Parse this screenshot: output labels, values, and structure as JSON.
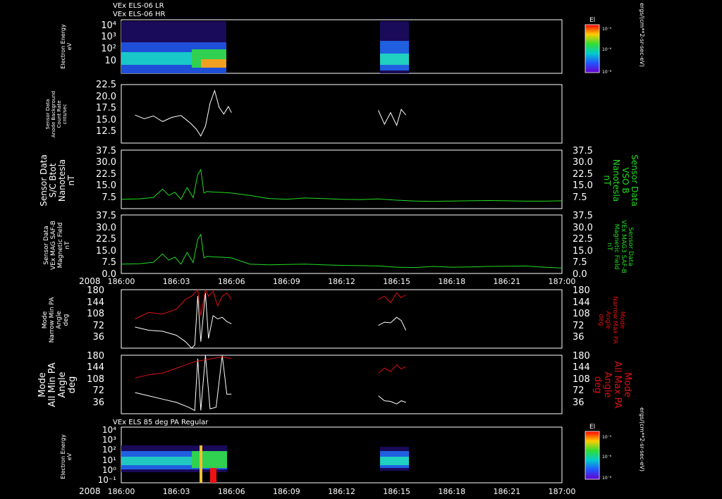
{
  "chart_data": [
    {
      "type": "heatmap",
      "titles": [
        "VEx ELS-06 LR",
        "VEx ELS-06 HR"
      ],
      "ylabel": [
        "Electron Energy",
        "eV"
      ],
      "yscale": "log",
      "yticks": [
        "10⁴",
        "10³",
        "10²",
        "10"
      ],
      "ylim": [
        1,
        20000
      ],
      "colorbar": {
        "label": "El",
        "unit": "ergs/(cm**2-sr-sec-eV)",
        "ticks": [
          "10⁻⁴",
          "10⁻⁶",
          "10⁻⁸"
        ]
      },
      "data_intervals": [
        [
          "186:00:45",
          "186:06:00"
        ],
        [
          "186:14:00",
          "186:15:30"
        ]
      ]
    },
    {
      "type": "line",
      "ylabel": [
        "Sensor Data",
        "Anode Background",
        "Count Rate",
        "cnts/sec"
      ],
      "yticks": [
        "22.5",
        "20.0",
        "17.5",
        "15.0",
        "12.5"
      ],
      "ylim": [
        10.0,
        22.5
      ],
      "series": [
        {
          "color": "#ffffff",
          "x": [
            "186:00:45",
            "186:01:15",
            "186:01:45",
            "186:02:15",
            "186:02:45",
            "186:03:15",
            "186:03:45",
            "186:04:05",
            "186:04:20",
            "186:04:35",
            "186:04:50",
            "186:05:05",
            "186:05:20",
            "186:05:35",
            "186:05:50",
            "186:06:00"
          ],
          "y": [
            16.0,
            15.2,
            15.8,
            14.6,
            15.5,
            15.9,
            14.3,
            13.0,
            11.5,
            13.6,
            18.5,
            21.2,
            17.6,
            16.2,
            17.8,
            16.5
          ]
        },
        {
          "color": "#ffffff",
          "x": [
            "186:14:00",
            "186:14:20",
            "186:14:40",
            "186:15:00",
            "186:15:15",
            "186:15:30"
          ],
          "y": [
            17.0,
            14.0,
            16.5,
            13.8,
            17.2,
            16.0
          ]
        }
      ]
    },
    {
      "type": "line",
      "ylabel": [
        "Sensor Data",
        "S/C Btot",
        "Nanotesla",
        "nT"
      ],
      "ylabel_right": [
        "Sensor Data",
        "VSO B",
        "Nanotesla",
        "nT"
      ],
      "yticks": [
        "37.5",
        "30.0",
        "22.5",
        "15.0",
        "7.5"
      ],
      "ylim": [
        0,
        37.5
      ],
      "series": [
        {
          "color": "#22dd22",
          "x": [
            "186:00:00",
            "186:01:00",
            "186:01:45",
            "186:02:15",
            "186:02:35",
            "186:02:55",
            "186:03:15",
            "186:03:35",
            "186:03:55",
            "186:04:10",
            "186:04:20",
            "186:04:30",
            "186:04:40",
            "186:05:00",
            "186:05:30",
            "186:06:00",
            "186:07:00",
            "186:08:00",
            "186:09:00",
            "186:10:00",
            "186:11:00",
            "186:12:00",
            "186:13:00",
            "186:14:00",
            "186:15:00",
            "186:16:00",
            "186:17:00",
            "186:18:00",
            "186:19:00",
            "186:20:00",
            "186:21:00",
            "186:22:00",
            "186:23:00",
            "186:24:00"
          ],
          "y": [
            6.0,
            6.3,
            7.2,
            12.5,
            8.5,
            10.5,
            6.0,
            13.5,
            7.0,
            22.0,
            25.0,
            10.0,
            11.0,
            10.6,
            10.4,
            10.0,
            8.5,
            6.5,
            6.0,
            6.8,
            6.4,
            6.0,
            5.8,
            6.2,
            5.4,
            4.9,
            4.6,
            4.9,
            5.0,
            5.2,
            5.0,
            4.8,
            4.8,
            5.0
          ]
        }
      ]
    },
    {
      "type": "line",
      "ylabel": [
        "Sensor Data",
        "VEx MAG SAF-B",
        "Magnetic Field",
        "nT"
      ],
      "ylabel_right": [
        "Sensor Data",
        "VEx MAG3 SAF-B",
        "Magnetic Field",
        "nT"
      ],
      "yticks": [
        "37.5",
        "30.0",
        "22.5",
        "15.0",
        "7.5",
        "0.0"
      ],
      "ylim": [
        0,
        37.5
      ],
      "series": [
        {
          "color": "#22dd22",
          "x": [
            "186:00:00",
            "186:01:00",
            "186:01:45",
            "186:02:15",
            "186:02:35",
            "186:02:55",
            "186:03:15",
            "186:03:35",
            "186:03:55",
            "186:04:10",
            "186:04:20",
            "186:04:30",
            "186:04:40",
            "186:05:00",
            "186:05:30",
            "186:06:00",
            "186:07:00",
            "186:08:00",
            "186:09:00",
            "186:10:00",
            "186:11:00",
            "186:12:00",
            "186:13:00",
            "186:14:00",
            "186:15:00",
            "186:16:00",
            "186:17:00",
            "186:18:00",
            "186:19:00",
            "186:20:00",
            "186:21:00",
            "186:22:00",
            "186:23:00",
            "186:24:00"
          ],
          "y": [
            6.0,
            6.3,
            7.2,
            12.5,
            8.5,
            10.5,
            6.0,
            13.5,
            7.0,
            22.0,
            25.0,
            10.0,
            11.0,
            10.6,
            10.4,
            10.0,
            6.0,
            5.5,
            5.8,
            6.0,
            5.5,
            5.2,
            5.0,
            4.8,
            4.0,
            3.8,
            4.5,
            4.0,
            4.2,
            4.5,
            4.6,
            4.8,
            4.0,
            3.5
          ]
        }
      ]
    },
    {
      "type": "line",
      "ylabel": [
        "Mode",
        "Narrow Min PA",
        "Angle",
        "deg"
      ],
      "ylabel_right": [
        "Mode",
        "Narrow Max PA",
        "Angle",
        "deg"
      ],
      "yticks": [
        "180",
        "144",
        "108",
        "72",
        "36"
      ],
      "ylim": [
        0,
        180
      ],
      "series": [
        {
          "color": "#ffffff",
          "x": [
            "186:00:45",
            "186:01:30",
            "186:02:15",
            "186:03:00",
            "186:03:30",
            "186:03:50",
            "186:04:00",
            "186:04:10",
            "186:04:20",
            "186:04:35",
            "186:04:45",
            "186:05:00",
            "186:05:15",
            "186:05:30",
            "186:05:45",
            "186:06:00"
          ],
          "y": [
            65,
            55,
            52,
            40,
            20,
            0,
            10,
            160,
            20,
            170,
            30,
            100,
            90,
            95,
            82,
            75
          ]
        },
        {
          "color": "#dd1111",
          "x": [
            "186:00:45",
            "186:01:30",
            "186:02:15",
            "186:03:00",
            "186:03:30",
            "186:03:50",
            "186:04:00",
            "186:04:10",
            "186:04:20",
            "186:04:35",
            "186:04:45",
            "186:05:00",
            "186:05:15",
            "186:05:30",
            "186:05:45",
            "186:06:00"
          ],
          "y": [
            90,
            110,
            105,
            120,
            150,
            160,
            170,
            180,
            100,
            180,
            160,
            175,
            130,
            160,
            170,
            150
          ]
        },
        {
          "color": "#ffffff",
          "x": [
            "186:14:00",
            "186:14:20",
            "186:14:40",
            "186:15:00",
            "186:15:15",
            "186:15:30"
          ],
          "y": [
            70,
            80,
            78,
            95,
            85,
            55
          ]
        },
        {
          "color": "#dd1111",
          "x": [
            "186:14:00",
            "186:14:20",
            "186:14:40",
            "186:15:00",
            "186:15:15",
            "186:15:30"
          ],
          "y": [
            150,
            160,
            140,
            170,
            155,
            165
          ]
        }
      ]
    },
    {
      "type": "line",
      "ylabel": [
        "Mode",
        "All Min PA",
        "Angle",
        "deg"
      ],
      "ylabel_right": [
        "Mode",
        "All Max PA",
        "Angle",
        "deg"
      ],
      "yticks": [
        "180",
        "144",
        "108",
        "72",
        "36"
      ],
      "ylim": [
        0,
        180
      ],
      "series": [
        {
          "color": "#ffffff",
          "x": [
            "186:00:45",
            "186:01:30",
            "186:02:15",
            "186:03:00",
            "186:03:40",
            "186:04:00",
            "186:04:10",
            "186:04:20",
            "186:04:35",
            "186:04:50",
            "186:05:10",
            "186:05:30",
            "186:05:45",
            "186:06:00"
          ],
          "y": [
            65,
            55,
            45,
            35,
            20,
            10,
            170,
            10,
            180,
            15,
            20,
            180,
            60,
            60
          ]
        },
        {
          "color": "#dd1111",
          "x": [
            "186:00:45",
            "186:01:30",
            "186:02:15",
            "186:03:00",
            "186:03:30",
            "186:04:00",
            "186:04:30",
            "186:05:00",
            "186:05:30",
            "186:06:00"
          ],
          "y": [
            110,
            120,
            125,
            140,
            150,
            160,
            165,
            170,
            175,
            170
          ]
        },
        {
          "color": "#ffffff",
          "x": [
            "186:14:00",
            "186:14:20",
            "186:14:40",
            "186:15:00",
            "186:15:15",
            "186:15:30"
          ],
          "y": [
            55,
            40,
            38,
            30,
            40,
            35
          ]
        },
        {
          "color": "#dd1111",
          "x": [
            "186:14:00",
            "186:14:20",
            "186:14:40",
            "186:15:00",
            "186:15:15",
            "186:15:30"
          ],
          "y": [
            125,
            140,
            130,
            150,
            138,
            145
          ]
        }
      ]
    },
    {
      "type": "heatmap",
      "title": "VEx ELS 85 deg PA Regular",
      "ylabel": [
        "Electron Energy",
        "eV"
      ],
      "yscale": "log",
      "yticks": [
        "10⁴",
        "10³",
        "10²",
        "10¹",
        "10⁰",
        "10⁻¹"
      ],
      "ylim": [
        0.1,
        20000
      ],
      "colorbar": {
        "label": "El",
        "unit": "ergs/(cm**2-sr-sec-eV)",
        "ticks": [
          "10⁻⁴",
          "10⁻⁶",
          "10⁻⁸"
        ]
      },
      "data_intervals": [
        [
          "186:00:45",
          "186:06:00"
        ],
        [
          "186:14:00",
          "186:15:30"
        ]
      ]
    }
  ],
  "xaxis": {
    "year": "2008",
    "ticks": [
      "186:00",
      "186:03",
      "186:06",
      "186:09",
      "186:12",
      "186:15",
      "186:18",
      "186:21",
      "187:00"
    ]
  },
  "colors": {
    "background": "#000000",
    "axes": "#ffffff",
    "green": "#22dd22",
    "red": "#dd1111"
  }
}
